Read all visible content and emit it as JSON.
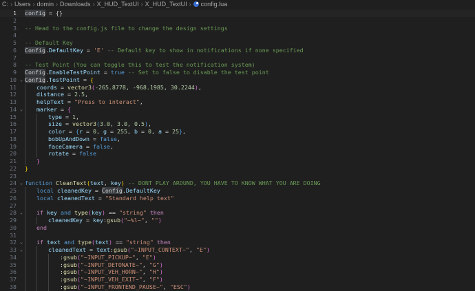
{
  "breadcrumb": {
    "parts": [
      "C:",
      "Users",
      "domin",
      "Downloads",
      "X_HUD_TextUI",
      "X_HUD_TextUI"
    ],
    "file": "config.lua",
    "file_icon": "lua-file-icon"
  },
  "editor": {
    "current_line": 1,
    "lines": [
      {
        "n": "1",
        "fold": "",
        "indent": 0,
        "tokens": [
          [
            "hl",
            "config"
          ],
          [
            "p",
            " = {}"
          ]
        ]
      },
      {
        "n": "2",
        "fold": "",
        "indent": 0,
        "tokens": []
      },
      {
        "n": "3",
        "fold": "",
        "indent": 0,
        "tokens": [
          [
            "c",
            "-- Head to the config.js file to change the design settings"
          ]
        ]
      },
      {
        "n": "4",
        "fold": "",
        "indent": 0,
        "tokens": []
      },
      {
        "n": "5",
        "fold": "",
        "indent": 0,
        "tokens": [
          [
            "c",
            "-- Default Key"
          ]
        ]
      },
      {
        "n": "6",
        "fold": "",
        "indent": 0,
        "tokens": [
          [
            "hl",
            "Config"
          ],
          [
            "p",
            "."
          ],
          [
            "v",
            "DefaultKey"
          ],
          [
            "p",
            " = "
          ],
          [
            "s",
            "'E'"
          ],
          [
            "c",
            " -- Default key to show in notifications if none specified"
          ]
        ]
      },
      {
        "n": "7",
        "fold": "",
        "indent": 0,
        "tokens": []
      },
      {
        "n": "8",
        "fold": "",
        "indent": 0,
        "tokens": [
          [
            "c",
            "-- Test Point (You can toggle this to test the notification system)"
          ]
        ]
      },
      {
        "n": "9",
        "fold": "",
        "indent": 0,
        "tokens": [
          [
            "hl",
            "Config"
          ],
          [
            "p",
            "."
          ],
          [
            "v",
            "EnableTestPoint"
          ],
          [
            "p",
            " = "
          ],
          [
            "kw",
            "true"
          ],
          [
            "c",
            " -- Set to false to disable the test point"
          ]
        ]
      },
      {
        "n": "10",
        "fold": "v",
        "indent": 0,
        "tokens": [
          [
            "hl",
            "Config"
          ],
          [
            "p",
            "."
          ],
          [
            "v",
            "TestPoint"
          ],
          [
            "p",
            " = "
          ],
          [
            "b",
            "{"
          ]
        ]
      },
      {
        "n": "11",
        "fold": "",
        "indent": 1,
        "tokens": [
          [
            "v",
            "coords"
          ],
          [
            "p",
            " = "
          ],
          [
            "f",
            "vector3"
          ],
          [
            "b2",
            "("
          ],
          [
            "n",
            "-265.8778"
          ],
          [
            "p",
            ", "
          ],
          [
            "n",
            "-968.1985"
          ],
          [
            "p",
            ", "
          ],
          [
            "n",
            "30.2244"
          ],
          [
            "b2",
            ")"
          ],
          [
            "p",
            ","
          ]
        ]
      },
      {
        "n": "12",
        "fold": "",
        "indent": 1,
        "tokens": [
          [
            "v",
            "distance"
          ],
          [
            "p",
            " = "
          ],
          [
            "n",
            "2.5"
          ],
          [
            "p",
            ","
          ]
        ]
      },
      {
        "n": "13",
        "fold": "",
        "indent": 1,
        "tokens": [
          [
            "v",
            "helpText"
          ],
          [
            "p",
            " = "
          ],
          [
            "s",
            "\"Press to interact\""
          ],
          [
            "p",
            ","
          ]
        ]
      },
      {
        "n": "14",
        "fold": "v",
        "indent": 1,
        "tokens": [
          [
            "v",
            "marker"
          ],
          [
            "p",
            " = "
          ],
          [
            "b2",
            "{"
          ]
        ]
      },
      {
        "n": "15",
        "fold": "",
        "indent": 2,
        "tokens": [
          [
            "v",
            "type"
          ],
          [
            "p",
            " = "
          ],
          [
            "n",
            "1"
          ],
          [
            "p",
            ","
          ]
        ]
      },
      {
        "n": "16",
        "fold": "",
        "indent": 2,
        "tokens": [
          [
            "v",
            "size"
          ],
          [
            "p",
            " = "
          ],
          [
            "f",
            "vector3"
          ],
          [
            "kw",
            "("
          ],
          [
            "n",
            "3.0"
          ],
          [
            "p",
            ", "
          ],
          [
            "n",
            "3.0"
          ],
          [
            "p",
            ", "
          ],
          [
            "n",
            "0.5"
          ],
          [
            "kw",
            ")"
          ],
          [
            "p",
            ","
          ]
        ]
      },
      {
        "n": "17",
        "fold": "",
        "indent": 2,
        "tokens": [
          [
            "v",
            "color"
          ],
          [
            "p",
            " = "
          ],
          [
            "kw",
            "{"
          ],
          [
            "v",
            "r"
          ],
          [
            "p",
            " = "
          ],
          [
            "n",
            "0"
          ],
          [
            "p",
            ", "
          ],
          [
            "v",
            "g"
          ],
          [
            "p",
            " = "
          ],
          [
            "n",
            "255"
          ],
          [
            "p",
            ", "
          ],
          [
            "v",
            "b"
          ],
          [
            "p",
            " = "
          ],
          [
            "n",
            "0"
          ],
          [
            "p",
            ", "
          ],
          [
            "v",
            "a"
          ],
          [
            "p",
            " = "
          ],
          [
            "n",
            "25"
          ],
          [
            "kw",
            "}"
          ],
          [
            "p",
            ","
          ]
        ]
      },
      {
        "n": "18",
        "fold": "",
        "indent": 2,
        "tokens": [
          [
            "v",
            "bobUpAndDown"
          ],
          [
            "p",
            " = "
          ],
          [
            "kw",
            "false"
          ],
          [
            "p",
            ","
          ]
        ]
      },
      {
        "n": "19",
        "fold": "",
        "indent": 2,
        "tokens": [
          [
            "v",
            "faceCamera"
          ],
          [
            "p",
            " = "
          ],
          [
            "kw",
            "false"
          ],
          [
            "p",
            ","
          ]
        ]
      },
      {
        "n": "20",
        "fold": "",
        "indent": 2,
        "tokens": [
          [
            "v",
            "rotate"
          ],
          [
            "p",
            " = "
          ],
          [
            "kw",
            "false"
          ]
        ]
      },
      {
        "n": "21",
        "fold": "",
        "indent": 1,
        "tokens": [
          [
            "b2",
            "}"
          ]
        ]
      },
      {
        "n": "22",
        "fold": "",
        "indent": 0,
        "tokens": [
          [
            "b",
            "}"
          ]
        ]
      },
      {
        "n": "23",
        "fold": "",
        "indent": 0,
        "tokens": []
      },
      {
        "n": "24",
        "fold": "v",
        "indent": 0,
        "tokens": [
          [
            "kw",
            "function"
          ],
          [
            "p",
            " "
          ],
          [
            "f",
            "CleanText"
          ],
          [
            "b",
            "("
          ],
          [
            "v",
            "text"
          ],
          [
            "p",
            ", "
          ],
          [
            "v",
            "key"
          ],
          [
            "b",
            ")"
          ],
          [
            "c",
            " -- DONT PLAY AROUND, YOU HAVE TO KNOW WHAT YOU ARE DOING"
          ]
        ]
      },
      {
        "n": "25",
        "fold": "",
        "indent": 1,
        "tokens": [
          [
            "kw",
            "local"
          ],
          [
            "p",
            " "
          ],
          [
            "v",
            "cleanedKey"
          ],
          [
            "p",
            " = "
          ],
          [
            "hl",
            "Config"
          ],
          [
            "p",
            "."
          ],
          [
            "v",
            "DefaultKey"
          ]
        ]
      },
      {
        "n": "26",
        "fold": "",
        "indent": 1,
        "tokens": [
          [
            "kw",
            "local"
          ],
          [
            "p",
            " "
          ],
          [
            "v",
            "cleanedText"
          ],
          [
            "p",
            " = "
          ],
          [
            "s",
            "\"Standard help text\""
          ]
        ]
      },
      {
        "n": "27",
        "fold": "",
        "indent": 1,
        "tokens": []
      },
      {
        "n": "28",
        "fold": "v",
        "indent": 1,
        "tokens": [
          [
            "k",
            "if"
          ],
          [
            "p",
            " "
          ],
          [
            "v",
            "key"
          ],
          [
            "p",
            " "
          ],
          [
            "kw",
            "and"
          ],
          [
            "p",
            " "
          ],
          [
            "f",
            "type"
          ],
          [
            "b2",
            "("
          ],
          [
            "v",
            "key"
          ],
          [
            "b2",
            ")"
          ],
          [
            "p",
            " == "
          ],
          [
            "s",
            "\"string\""
          ],
          [
            "p",
            " "
          ],
          [
            "k",
            "then"
          ]
        ]
      },
      {
        "n": "29",
        "fold": "",
        "indent": 2,
        "tokens": [
          [
            "v",
            "cleanedKey"
          ],
          [
            "p",
            " = "
          ],
          [
            "v",
            "key"
          ],
          [
            "p",
            ":"
          ],
          [
            "f",
            "gsub"
          ],
          [
            "b2",
            "("
          ],
          [
            "s",
            "\"~%l~\""
          ],
          [
            "p",
            ", "
          ],
          [
            "s",
            "\"\""
          ],
          [
            "b2",
            ")"
          ]
        ]
      },
      {
        "n": "30",
        "fold": "",
        "indent": 1,
        "tokens": [
          [
            "k",
            "end"
          ]
        ]
      },
      {
        "n": "31",
        "fold": "",
        "indent": 1,
        "tokens": []
      },
      {
        "n": "32",
        "fold": "v",
        "indent": 1,
        "tokens": [
          [
            "k",
            "if"
          ],
          [
            "p",
            " "
          ],
          [
            "v",
            "text"
          ],
          [
            "p",
            " "
          ],
          [
            "kw",
            "and"
          ],
          [
            "p",
            " "
          ],
          [
            "f",
            "type"
          ],
          [
            "b2",
            "("
          ],
          [
            "v",
            "text"
          ],
          [
            "b2",
            ")"
          ],
          [
            "p",
            " == "
          ],
          [
            "s",
            "\"string\""
          ],
          [
            "p",
            " "
          ],
          [
            "k",
            "then"
          ]
        ]
      },
      {
        "n": "33",
        "fold": "v",
        "indent": 2,
        "tokens": [
          [
            "v",
            "cleanedText"
          ],
          [
            "p",
            " = "
          ],
          [
            "v",
            "text"
          ],
          [
            "p",
            ":"
          ],
          [
            "f",
            "gsub"
          ],
          [
            "b2",
            "("
          ],
          [
            "s",
            "\"~INPUT_CONTEXT~\""
          ],
          [
            "p",
            ", "
          ],
          [
            "s",
            "\"E\""
          ],
          [
            "b2",
            ")"
          ]
        ]
      },
      {
        "n": "34",
        "fold": "",
        "indent": 3,
        "tokens": [
          [
            "p",
            ":"
          ],
          [
            "f",
            "gsub"
          ],
          [
            "b2",
            "("
          ],
          [
            "s",
            "\"~INPUT_PICKUP~\""
          ],
          [
            "p",
            ", "
          ],
          [
            "s",
            "\"E\""
          ],
          [
            "b2",
            ")"
          ]
        ]
      },
      {
        "n": "35",
        "fold": "",
        "indent": 3,
        "tokens": [
          [
            "p",
            ":"
          ],
          [
            "f",
            "gsub"
          ],
          [
            "b2",
            "("
          ],
          [
            "s",
            "\"~INPUT_DETONATE~\""
          ],
          [
            "p",
            ", "
          ],
          [
            "s",
            "\"G\""
          ],
          [
            "b2",
            ")"
          ]
        ]
      },
      {
        "n": "36",
        "fold": "",
        "indent": 3,
        "tokens": [
          [
            "p",
            ":"
          ],
          [
            "f",
            "gsub"
          ],
          [
            "b2",
            "("
          ],
          [
            "s",
            "\"~INPUT_VEH_HORN~\""
          ],
          [
            "p",
            ", "
          ],
          [
            "s",
            "\"H\""
          ],
          [
            "b2",
            ")"
          ]
        ]
      },
      {
        "n": "37",
        "fold": "",
        "indent": 3,
        "tokens": [
          [
            "p",
            ":"
          ],
          [
            "f",
            "gsub"
          ],
          [
            "b2",
            "("
          ],
          [
            "s",
            "\"~INPUT_VEH_EXIT~\""
          ],
          [
            "p",
            ", "
          ],
          [
            "s",
            "\"F\""
          ],
          [
            "b2",
            ")"
          ]
        ]
      },
      {
        "n": "38",
        "fold": "",
        "indent": 3,
        "tokens": [
          [
            "p",
            ":"
          ],
          [
            "f",
            "gsub"
          ],
          [
            "b2",
            "("
          ],
          [
            "s",
            "\"~INPUT_FRONTEND_PAUSE~\""
          ],
          [
            "p",
            ", "
          ],
          [
            "s",
            "\"ESC\""
          ],
          [
            "b2",
            ")"
          ]
        ]
      }
    ]
  }
}
